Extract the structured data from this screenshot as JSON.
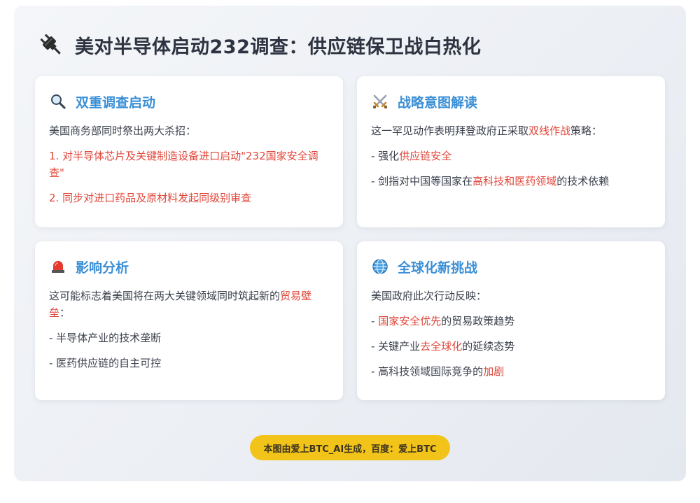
{
  "header": {
    "icon": "plug-icon",
    "title": "美对半导体启动232调查：供应链保卫战白热化"
  },
  "cards": [
    {
      "icon": "magnifier-icon",
      "title": "双重调查启动",
      "intro": "美国商务部同时祭出两大杀招：",
      "point1": "1. 对半导体芯片及关键制造设备进口启动\"232国家安全调查\"",
      "point2": "2. 同步对进口药品及原材料发起同级别审查"
    },
    {
      "icon": "crossed-swords-icon",
      "title": "战略意图解读",
      "intro_pre": "这一罕见动作表明拜登政府正采取",
      "intro_hl": "双线作战",
      "intro_post": "策略：",
      "b1_pre": "- 强化",
      "b1_hl": "供应链安全",
      "b2_pre": "- 剑指对中国等国家在",
      "b2_hl": "高科技和医药领域",
      "b2_post": "的技术依赖"
    },
    {
      "icon": "siren-icon",
      "title": "影响分析",
      "intro_pre": "这可能标志着美国将在两大关键领域同时筑起新的",
      "intro_hl": "贸易壁垒",
      "intro_post": "：",
      "b1": "- 半导体产业的技术垄断",
      "b2": "- 医药供应链的自主可控"
    },
    {
      "icon": "globe-icon",
      "title": "全球化新挑战",
      "intro": "美国政府此次行动反映：",
      "b1_pre": "- ",
      "b1_hl": "国家安全优先",
      "b1_post": "的贸易政策趋势",
      "b2_pre": "- 关键产业",
      "b2_hl": "去全球化",
      "b2_post": "的延续态势",
      "b3_pre": "- 高科技领域国际竞争的",
      "b3_hl": "加剧"
    }
  ],
  "footer": {
    "badge": "本图由爱上BTC_AI生成，百度：爱上BTC"
  },
  "colors": {
    "accent_blue": "#3b8fd6",
    "highlight_red": "#e0463a",
    "badge_yellow": "#f2c318"
  }
}
